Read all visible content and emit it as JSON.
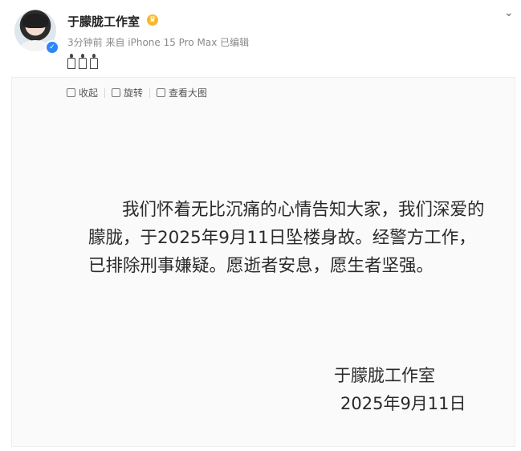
{
  "post": {
    "author": "于朦胧工作室",
    "meta": "3分钟前 来自 iPhone 15 Pro Max 已编辑",
    "candles": "🕯🕯🕯"
  },
  "toolbar": {
    "collapse": "收起",
    "rotate": "旋转",
    "view_large": "查看大图"
  },
  "image": {
    "body": "我们怀着无比沉痛的心情告知大家，我们深爱的朦胧，于2025年9月11日坠楼身故。经警方工作，已排除刑事嫌疑。愿逝者安息，愿生者坚强。",
    "signature": "于朦胧工作室",
    "date": "2025年9月11日"
  }
}
